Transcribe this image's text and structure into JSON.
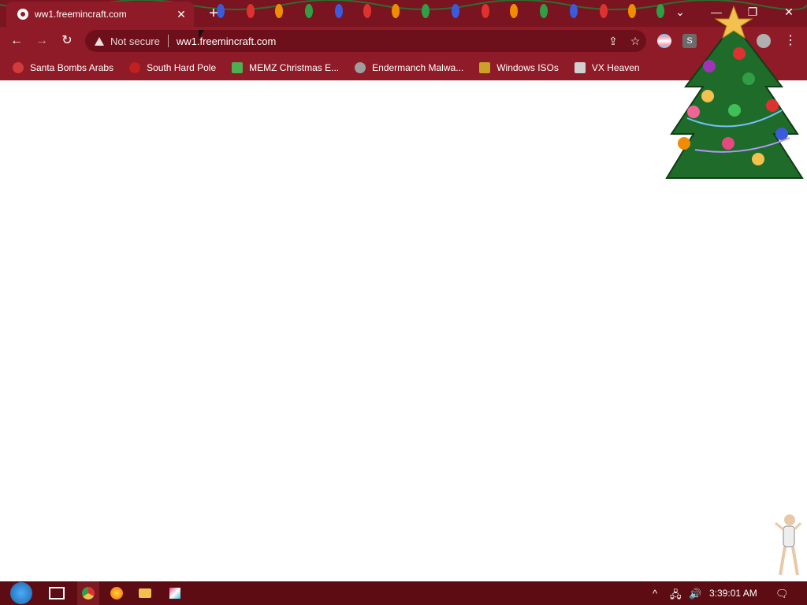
{
  "tab": {
    "title": "ww1.freemincraft.com",
    "close_label": "✕"
  },
  "newtab_label": "+",
  "window_controls": {
    "dropdown": "⌄",
    "minimize": "—",
    "restore": "❐",
    "close": "✕"
  },
  "nav": {
    "back": "←",
    "forward": "→",
    "reload": "↻"
  },
  "omnibox": {
    "security_text": "Not secure",
    "url": "ww1.freemincraft.com",
    "share": "⇪",
    "star": "☆"
  },
  "extensions": {
    "ext2": "S",
    "profile": "👤",
    "menu": "⋮"
  },
  "bookmarks": [
    {
      "label": "Santa Bombs Arabs",
      "color": "#d23b3b"
    },
    {
      "label": "South Hard Pole",
      "color": "#c02020"
    },
    {
      "label": "MEMZ Christmas E...",
      "color": "#4caf50"
    },
    {
      "label": "Endermanch Malwa...",
      "color": "#9e9e9e"
    },
    {
      "label": "Windows ISOs",
      "color": "#c9a227"
    },
    {
      "label": "VX Heaven",
      "color": "#d0d0d0"
    }
  ],
  "taskbar": {
    "clock": "3:39:01 AM",
    "tray_up": "^",
    "network": "🖧",
    "volume": "🔊",
    "notify": "🗨"
  }
}
